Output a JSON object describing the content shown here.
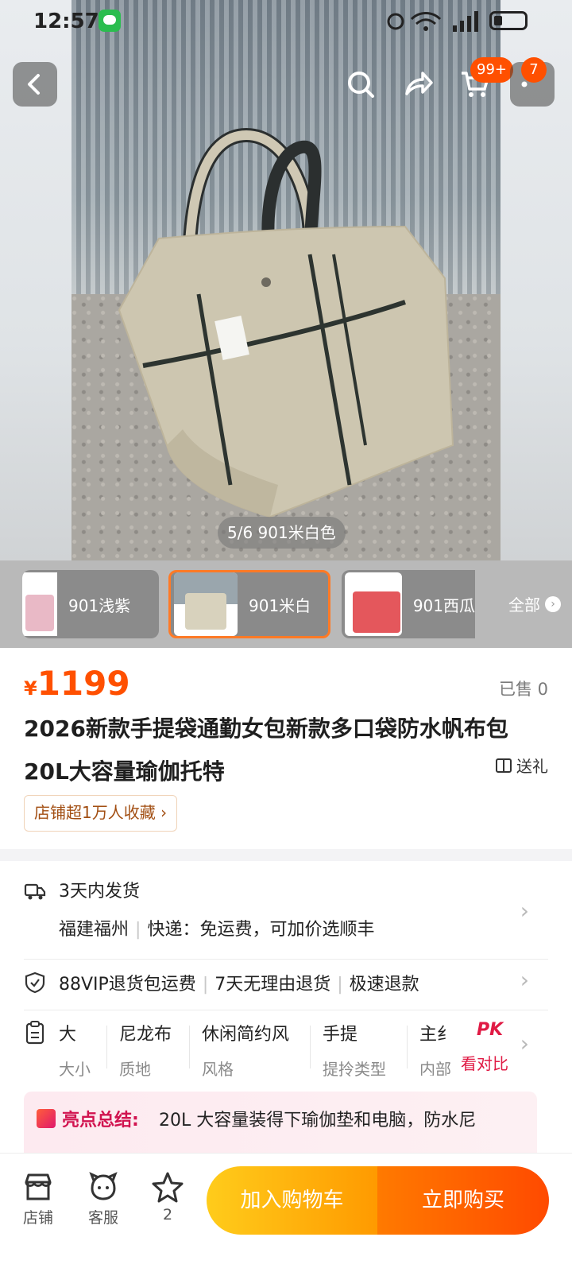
{
  "status_bar": {
    "time": "12:57"
  },
  "top_actions": {
    "cart_badge": "99+",
    "more_badge": "7"
  },
  "gallery": {
    "counter": "5/6 901米白色"
  },
  "variants": {
    "items": [
      {
        "label": "901浅紫",
        "color": "#e9b9c6"
      },
      {
        "label": "901米白",
        "color": "#d8d2bd",
        "selected": true
      },
      {
        "label": "901西瓜",
        "color": "#e4575c"
      }
    ],
    "all_label": "全部"
  },
  "product": {
    "currency": "¥",
    "price": "1199",
    "sold": "已售 0",
    "title": "2026新款手提袋通勤女包新款多口袋防水帆布包20L大容量瑜伽托特",
    "gift_label": "送礼",
    "shop_favorites": "店铺超1万人收藏"
  },
  "shipping": {
    "dispatch": "3天内发货",
    "origin": "福建福州",
    "delivery": "快递：免运费，可加价选顺丰"
  },
  "guarantees": [
    "88VIP退货包运费",
    "7天无理由退货",
    "极速退款"
  ],
  "attributes": [
    {
      "value": "大",
      "key": "大小"
    },
    {
      "value": "尼龙布",
      "key": "质地"
    },
    {
      "value": "休闲简约风",
      "key": "风格"
    },
    {
      "value": "手提",
      "key": "提拎类型"
    },
    {
      "value": "主纟",
      "key": "内部"
    }
  ],
  "compare": {
    "logo": "PK",
    "label": "看对比"
  },
  "highlight": {
    "label": "亮点总结:",
    "text": "20L 大容量装得下瑜伽垫和电脑，防水尼"
  },
  "bottom_bar": {
    "shop_label": "店铺",
    "service_label": "客服",
    "favorite_count": "2",
    "add_to_cart": "加入购物车",
    "buy_now": "立即购买"
  },
  "colors": {
    "accent": "#ff5000",
    "highlight": "#d1134f"
  }
}
